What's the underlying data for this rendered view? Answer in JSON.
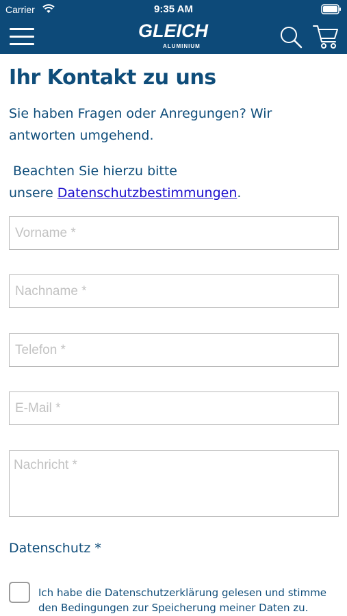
{
  "status_bar": {
    "carrier": "Carrier",
    "time": "9:35 AM"
  },
  "header": {
    "logo_text": "GLEICH",
    "logo_subtext": "ALUMINIUM",
    "background_color": "#0d4a79",
    "icons": [
      "menu-icon",
      "search-icon",
      "cart-icon"
    ]
  },
  "content": {
    "title": "Ihr Kontakt zu uns",
    "intro": "Sie haben Fragen oder Anregungen? Wir antworten umgehend.",
    "note_line1": "Beachten Sie hierzu bitte",
    "note_prefix": "unsere ",
    "privacy_link": "Datenschutzbestimmungen",
    "note_suffix": "."
  },
  "form": {
    "firstname_placeholder": "Vorname *",
    "lastname_placeholder": "Nachname *",
    "phone_placeholder": "Telefon *",
    "email_placeholder": "E-Mail *",
    "message_placeholder": "Nachricht *",
    "privacy_title": "Datenschutz *",
    "consent_text": "Ich habe die Datenschutzerklärung gelesen und stimme den Bedingungen zur Speicherung meiner Daten zu."
  },
  "colors": {
    "accent_text": "#0f4d7a",
    "link": "#1a0dcc"
  }
}
